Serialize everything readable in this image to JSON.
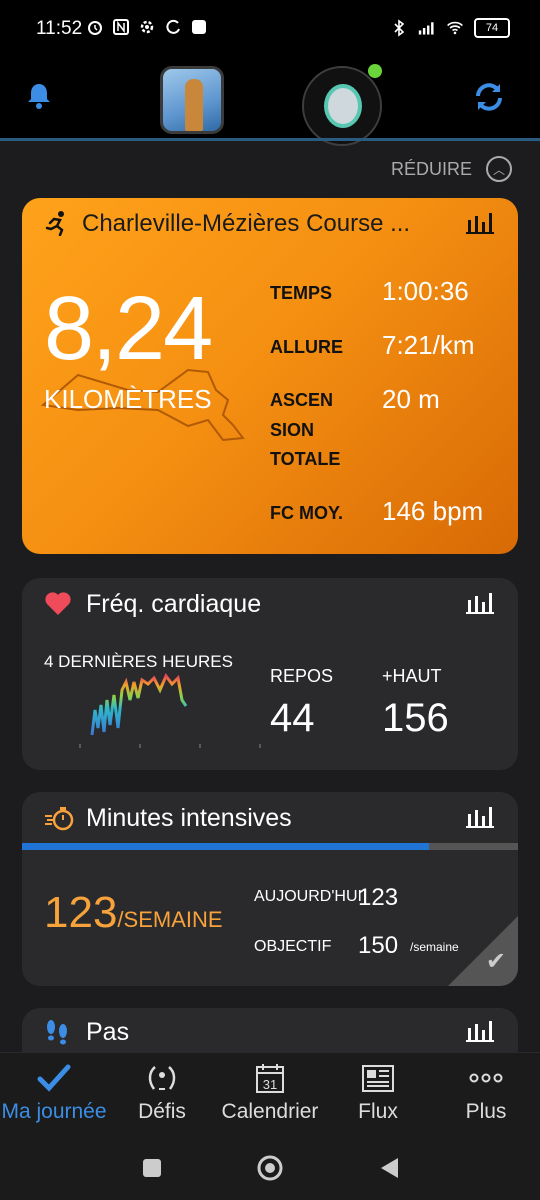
{
  "status_bar": {
    "time": "11:52",
    "battery": "74"
  },
  "reduce_label": "RÉDUIRE",
  "activity": {
    "title": "Charleville-Mézières Course ...",
    "distance": "8,24",
    "distance_unit": "KILOMÈTRES",
    "stats": [
      {
        "label": "TEMPS",
        "value": "1:00:36"
      },
      {
        "label": "ALLURE",
        "value": "7:21/km"
      },
      {
        "label_lines": [
          "ASCEN",
          "SION",
          "TOTALE"
        ],
        "value": "20 m"
      },
      {
        "label": "FC MOY.",
        "value": "146 bpm"
      }
    ]
  },
  "heart_rate": {
    "title": "Fréq. cardiaque",
    "subtitle": "4 DERNIÈRES HEURES",
    "rest_label": "REPOS",
    "rest_value": "44",
    "high_label": "+HAUT",
    "high_value": "156"
  },
  "intensity": {
    "title": "Minutes intensives",
    "value": "123",
    "unit": "/SEMAINE",
    "today_label": "AUJOURD'HUI",
    "today_value": "123",
    "goal_label": "OBJECTIF",
    "goal_value": "150",
    "goal_unit": "/semaine",
    "progress": 0.82
  },
  "steps": {
    "title": "Pas"
  },
  "nav": [
    {
      "label": "Ma journée",
      "icon": "check-icon",
      "active": true
    },
    {
      "label": "Défis",
      "icon": "laurel-icon"
    },
    {
      "label": "Calendrier",
      "icon": "calendar-icon",
      "day": "31"
    },
    {
      "label": "Flux",
      "icon": "newsfeed-icon"
    },
    {
      "label": "Plus",
      "icon": "more-icon"
    }
  ],
  "colors": {
    "accent": "#3c8de5",
    "activity": "#f59012",
    "intensity_value": "#f7a23b"
  }
}
